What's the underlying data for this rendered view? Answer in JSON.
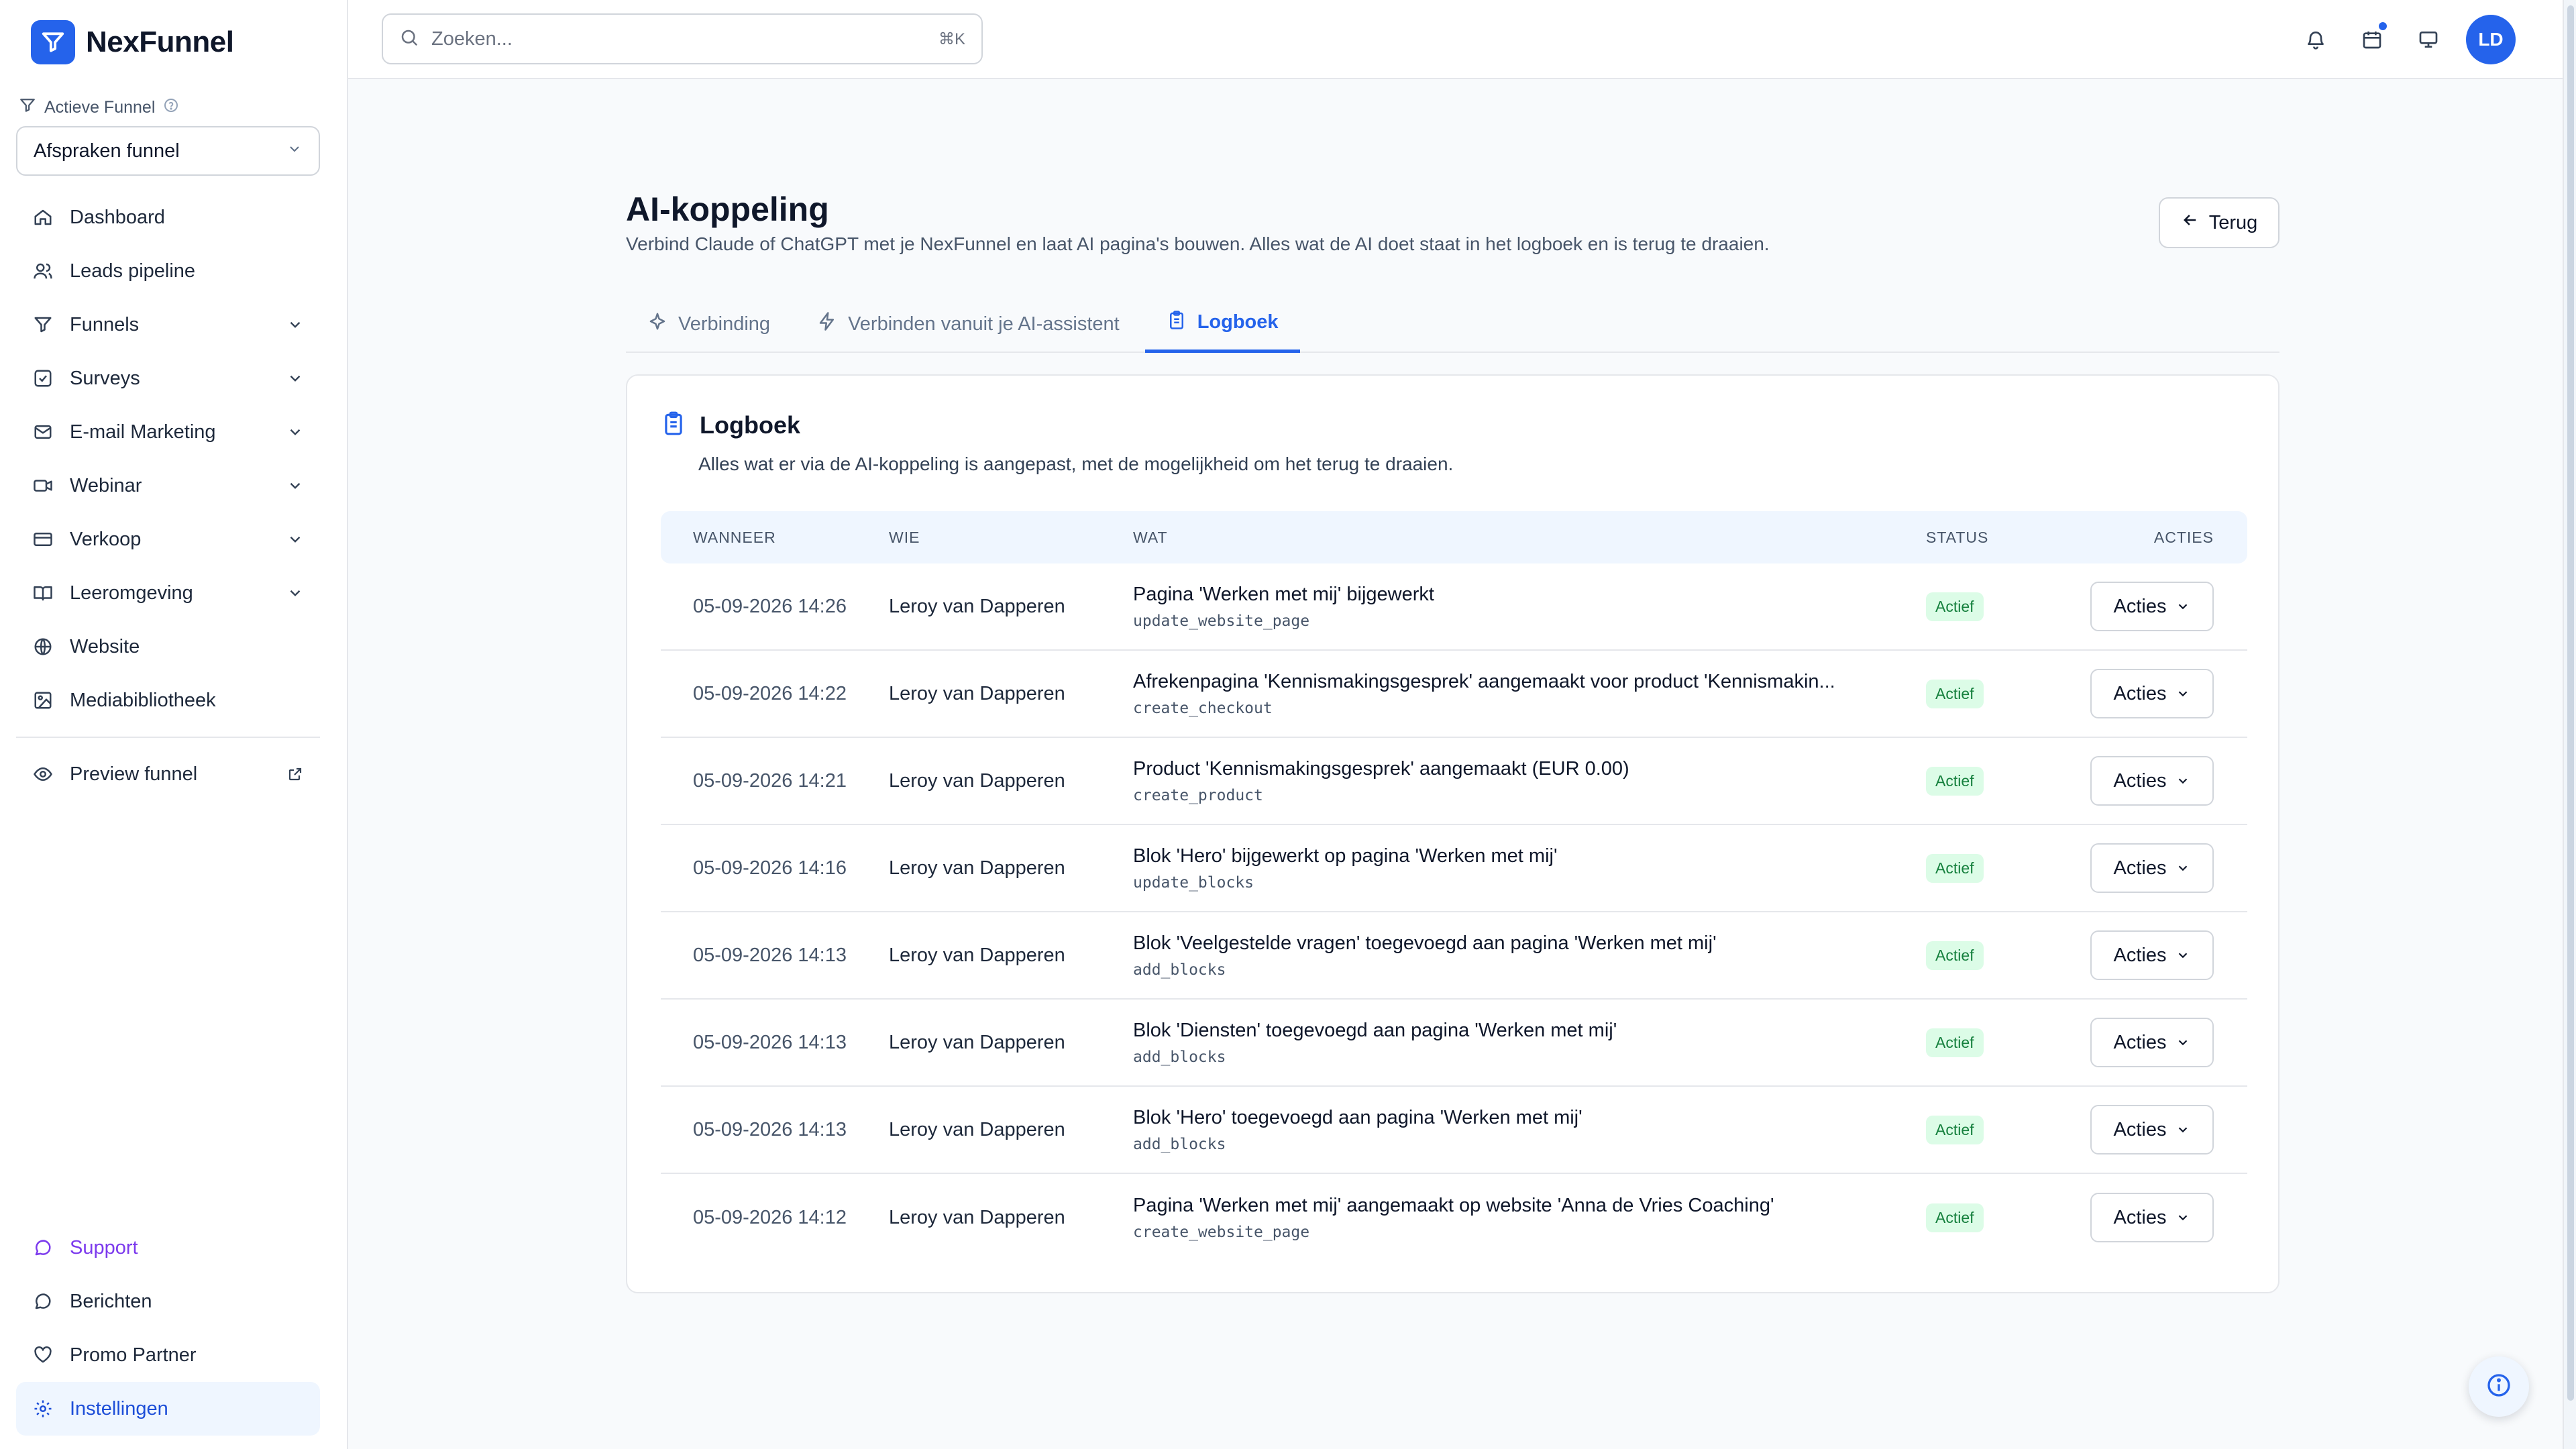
{
  "brand": {
    "name": "NexFunnel",
    "accent": "#2563eb"
  },
  "sidebar": {
    "funnel_label": "Actieve Funnel",
    "funnel_value": "Afspraken funnel",
    "items": [
      {
        "label": "Dashboard",
        "icon": "home-icon"
      },
      {
        "label": "Leads pipeline",
        "icon": "users-icon"
      },
      {
        "label": "Funnels",
        "icon": "filter-icon"
      },
      {
        "label": "Surveys",
        "icon": "checkbox-icon"
      },
      {
        "label": "E-mail Marketing",
        "icon": "mail-icon"
      },
      {
        "label": "Webinar",
        "icon": "video-icon"
      },
      {
        "label": "Verkoop",
        "icon": "credit-card-icon"
      },
      {
        "label": "Leeromgeving",
        "icon": "book-icon"
      },
      {
        "label": "Website",
        "icon": "globe-icon"
      },
      {
        "label": "Mediabibliotheek",
        "icon": "image-icon"
      },
      {
        "label": "Preview funnel",
        "icon": "eye-icon"
      }
    ],
    "bottom": [
      {
        "label": "Support",
        "icon": "chat-icon"
      },
      {
        "label": "Berichten",
        "icon": "message-icon"
      },
      {
        "label": "Promo Partner",
        "icon": "heart-icon"
      },
      {
        "label": "Instellingen",
        "icon": "gear-icon"
      }
    ]
  },
  "topbar": {
    "search_placeholder": "Zoeken...",
    "search_shortcut": "⌘K",
    "avatar_initials": "LD"
  },
  "page": {
    "title": "AI-koppeling",
    "subtitle": "Verbind Claude of ChatGPT met je NexFunnel en laat AI pagina's bouwen. Alles wat de AI doet staat in het logboek en is terug te draaien.",
    "back_label": "Terug",
    "tabs": [
      {
        "label": "Verbinding"
      },
      {
        "label": "Verbinden vanuit je AI-assistent"
      },
      {
        "label": "Logboek"
      }
    ]
  },
  "logbook": {
    "title": "Logboek",
    "subtitle": "Alles wat er via de AI-koppeling is aangepast, met de mogelijkheid om het terug te draaien.",
    "columns": {
      "when": "WANNEER",
      "who": "WIE",
      "what": "WAT",
      "status": "STATUS",
      "actions": "ACTIES"
    },
    "actions_label": "Acties",
    "rows": [
      {
        "when": "05-09-2026 14:26",
        "who": "Leroy van Dapperen",
        "what": "Pagina 'Werken met mij' bijgewerkt",
        "code": "update_website_page",
        "status": "Actief"
      },
      {
        "when": "05-09-2026 14:22",
        "who": "Leroy van Dapperen",
        "what": "Afrekenpagina 'Kennismakingsgesprek' aangemaakt voor product 'Kennismakin...",
        "code": "create_checkout",
        "status": "Actief"
      },
      {
        "when": "05-09-2026 14:21",
        "who": "Leroy van Dapperen",
        "what": "Product 'Kennismakingsgesprek' aangemaakt (EUR 0.00)",
        "code": "create_product",
        "status": "Actief"
      },
      {
        "when": "05-09-2026 14:16",
        "who": "Leroy van Dapperen",
        "what": "Blok 'Hero' bijgewerkt op pagina 'Werken met mij'",
        "code": "update_blocks",
        "status": "Actief"
      },
      {
        "when": "05-09-2026 14:13",
        "who": "Leroy van Dapperen",
        "what": "Blok 'Veelgestelde vragen' toegevoegd aan pagina 'Werken met mij'",
        "code": "add_blocks",
        "status": "Actief"
      },
      {
        "when": "05-09-2026 14:13",
        "who": "Leroy van Dapperen",
        "what": "Blok 'Diensten' toegevoegd aan pagina 'Werken met mij'",
        "code": "add_blocks",
        "status": "Actief"
      },
      {
        "when": "05-09-2026 14:13",
        "who": "Leroy van Dapperen",
        "what": "Blok 'Hero' toegevoegd aan pagina 'Werken met mij'",
        "code": "add_blocks",
        "status": "Actief"
      },
      {
        "when": "05-09-2026 14:12",
        "who": "Leroy van Dapperen",
        "what": "Pagina 'Werken met mij' aangemaakt op website 'Anna de Vries Coaching'",
        "code": "create_website_page",
        "status": "Actief"
      }
    ]
  }
}
